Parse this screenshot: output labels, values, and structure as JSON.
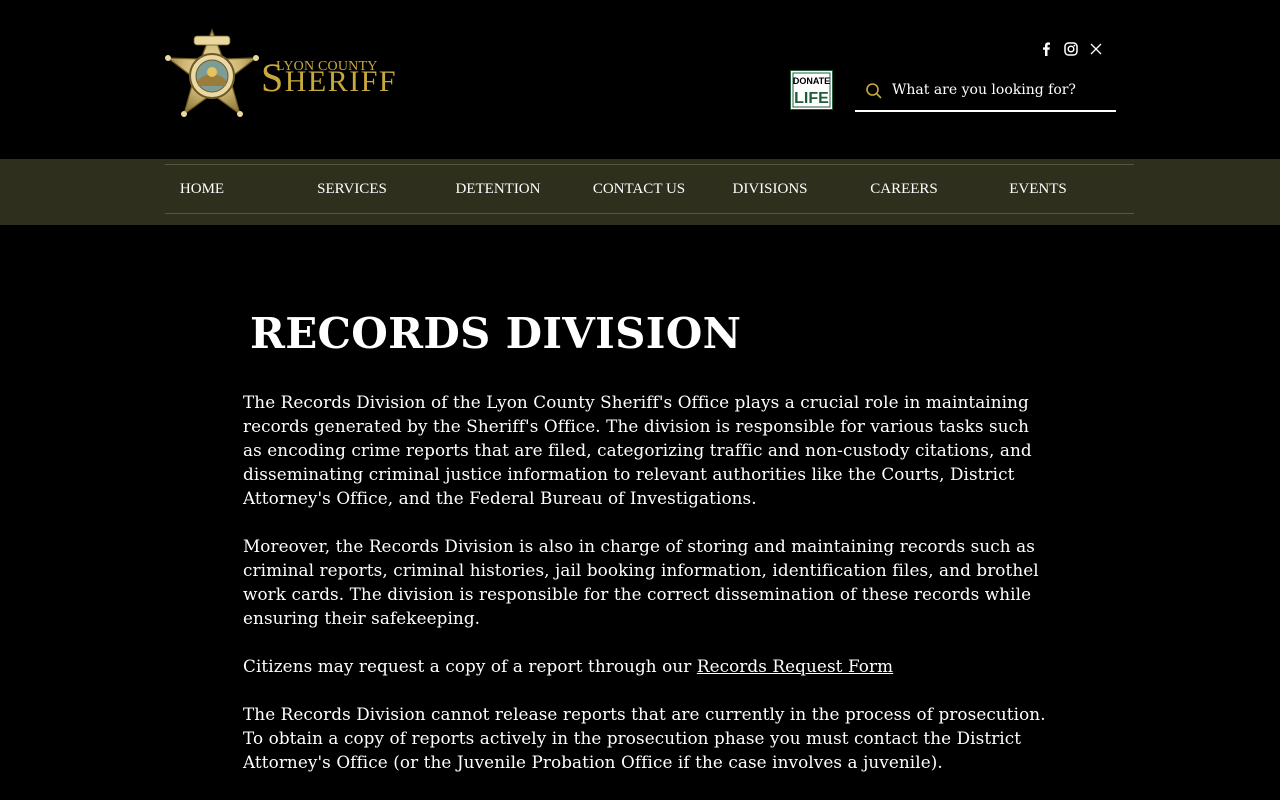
{
  "header": {
    "logo": {
      "county_text": "LYON COUNTY",
      "sheriff_initial": "S",
      "sheriff_rest": "HERIFF",
      "badge_icon": "sheriff-star-badge",
      "gold": "#c8a93e"
    },
    "social": [
      {
        "name": "facebook-icon"
      },
      {
        "name": "instagram-icon"
      },
      {
        "name": "x-twitter-icon"
      }
    ],
    "donate_life": {
      "top": "DONATE",
      "bottom": "LIFE"
    },
    "search": {
      "placeholder": "What are you looking for?",
      "value": ""
    }
  },
  "nav": {
    "background": "#2e2f1c",
    "items": [
      {
        "label": "HOME"
      },
      {
        "label": "SERVICES"
      },
      {
        "label": "DETENTION"
      },
      {
        "label": "CONTACT US"
      },
      {
        "label": "DIVISIONS"
      },
      {
        "label": "CAREERS"
      },
      {
        "label": "EVENTS"
      }
    ]
  },
  "main": {
    "title": "RECORDS DIVISION",
    "paragraphs": [
      "The Records Division of the Lyon County Sheriff's Office plays a crucial role in maintaining records generated by the Sheriff's Office. The division is responsible for various tasks such as encoding crime reports that are filed, categorizing traffic and non-custody citations, and disseminating criminal justice information to relevant authorities like the Courts, District Attorney's Office, and the Federal Bureau of Investigations.",
      "Moreover, the Records Division is also in charge of storing and maintaining records such as criminal reports, criminal histories, jail booking information, identification files, and brothel work cards. The division is responsible for the correct dissemination of these records while ensuring their safekeeping."
    ],
    "request_text": "Citizens may request a copy of a report through our ",
    "request_link": "Records Request Form ",
    "prosecution_text": "The Records Division cannot release reports that are currently in the process of prosecution. To obtain a copy of reports actively in the prosecution phase you must contact the District Attorney's Office (or the Juvenile Probation Office if the case involves a juvenile)."
  }
}
